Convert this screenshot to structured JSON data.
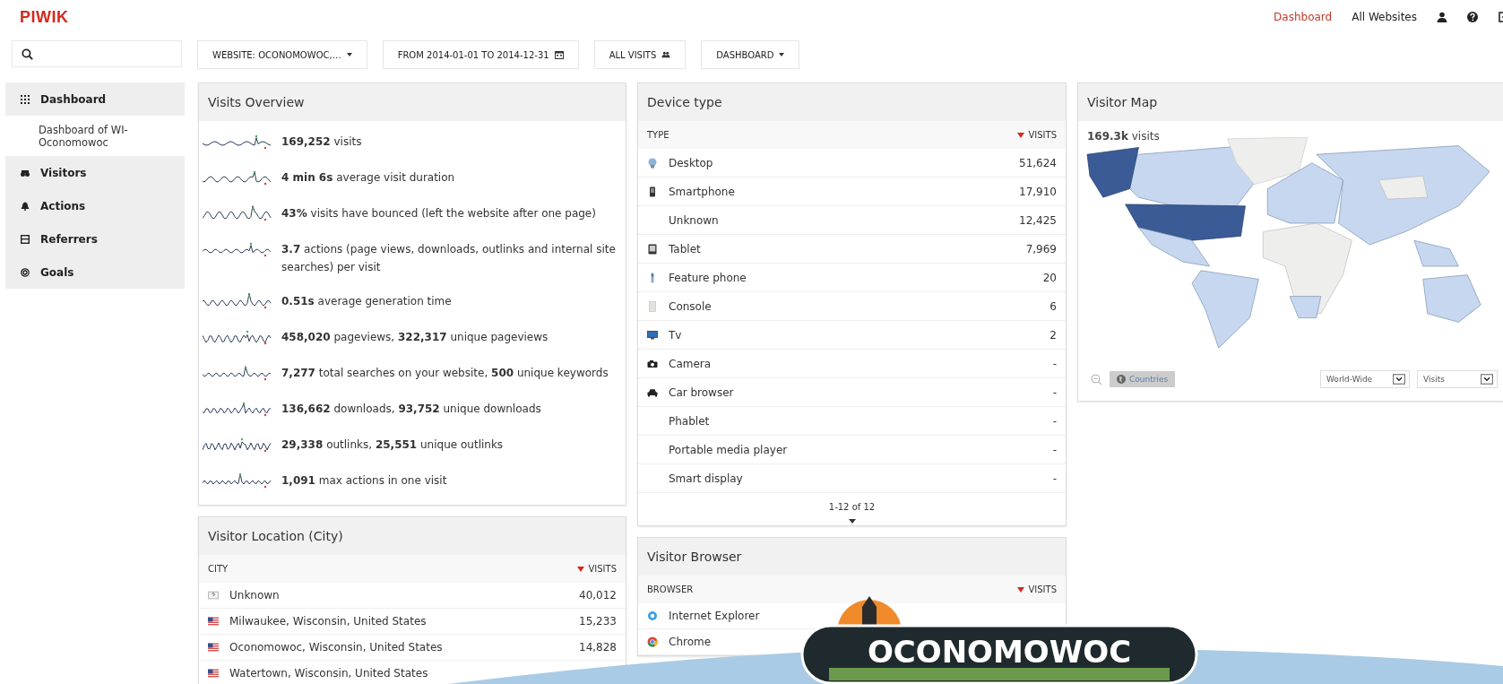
{
  "header": {
    "logo": "PIWIK",
    "nav": [
      {
        "label": "Dashboard",
        "selected": true
      },
      {
        "label": "All Websites",
        "selected": false
      }
    ]
  },
  "filters": [
    {
      "label": "WEBSITE: OCONOMOWOC,…",
      "kind": "dropdown"
    },
    {
      "label": "FROM 2014-01-01 TO 2014-12-31",
      "kind": "calendar"
    },
    {
      "label": "ALL VISITS",
      "kind": "segment"
    },
    {
      "label": "DASHBOARD",
      "kind": "dropdown"
    }
  ],
  "sidebar": [
    {
      "label": "Dashboard",
      "kind": "grid",
      "children": [
        {
          "label": "Dashboard of WI-Oconomowoc"
        }
      ]
    },
    {
      "label": "Visitors",
      "kind": "binoculars"
    },
    {
      "label": "Actions",
      "kind": "bell"
    },
    {
      "label": "Referrers",
      "kind": "page"
    },
    {
      "label": "Goals",
      "kind": "target"
    }
  ],
  "visits_overview": {
    "title": "Visits Overview",
    "items": [
      {
        "text": "**169,252** visits"
      },
      {
        "text": "**4 min 6s** average visit duration"
      },
      {
        "text": "**43%** visits have bounced (left the website after one page)"
      },
      {
        "text": "**3.7** actions (page views, downloads, outlinks and internal site searches) per visit"
      },
      {
        "text": "**0.51s** average generation time"
      },
      {
        "text": "**458,020** pageviews, **322,317** unique pageviews"
      },
      {
        "text": "**7,277** total searches on your website, **500** unique keywords"
      },
      {
        "text": "**136,662** downloads, **93,752** unique downloads"
      },
      {
        "text": "**29,338** outlinks, **25,551** unique outlinks"
      },
      {
        "text": "**1,091** max actions in one visit"
      }
    ]
  },
  "device_type": {
    "title": "Device type",
    "columns": [
      "TYPE",
      "VISITS"
    ],
    "rows": [
      {
        "label": "Desktop",
        "value": "51,624",
        "kind": "desktop"
      },
      {
        "label": "Smartphone",
        "value": "17,910",
        "kind": "smartphone"
      },
      {
        "label": "Unknown",
        "value": "12,425",
        "kind": "none"
      },
      {
        "label": "Tablet",
        "value": "7,969",
        "kind": "tablet"
      },
      {
        "label": "Feature phone",
        "value": "20",
        "kind": "phone"
      },
      {
        "label": "Console",
        "value": "6",
        "kind": "console"
      },
      {
        "label": "Tv",
        "value": "2",
        "kind": "tv"
      },
      {
        "label": "Camera",
        "value": "-",
        "kind": "camera"
      },
      {
        "label": "Car browser",
        "value": "-",
        "kind": "car"
      },
      {
        "label": "Phablet",
        "value": "-",
        "kind": "none"
      },
      {
        "label": "Portable media player",
        "value": "-",
        "kind": "none"
      },
      {
        "label": "Smart display",
        "value": "-",
        "kind": "none"
      }
    ],
    "pagination": "1-12 of 12"
  },
  "visitor_map": {
    "title": "Visitor Map",
    "summary": "**169.3k** visits",
    "mode_button": "Countries",
    "selects": [
      "World-Wide",
      "Visits"
    ]
  },
  "visitor_location": {
    "title": "Visitor Location (City)",
    "columns": [
      "CITY",
      "VISITS"
    ],
    "rows": [
      {
        "label": "Unknown",
        "value": "40,012",
        "kind": "unknown"
      },
      {
        "label": "Milwaukee, Wisconsin, United States",
        "value": "15,233",
        "kind": "flag"
      },
      {
        "label": "Oconomowoc, Wisconsin, United States",
        "value": "14,828",
        "kind": "flag"
      },
      {
        "label": "Watertown, Wisconsin, United States",
        "kind": "flag"
      }
    ]
  },
  "visitor_browser": {
    "title": "Visitor Browser",
    "columns": [
      "BROWSER",
      "VISITS"
    ],
    "rows": [
      {
        "label": "Internet Explorer",
        "kind": "ie"
      },
      {
        "label": "Chrome",
        "kind": "chrome"
      }
    ]
  },
  "overlay_logo": {
    "text": "OCONOMOWOC"
  }
}
